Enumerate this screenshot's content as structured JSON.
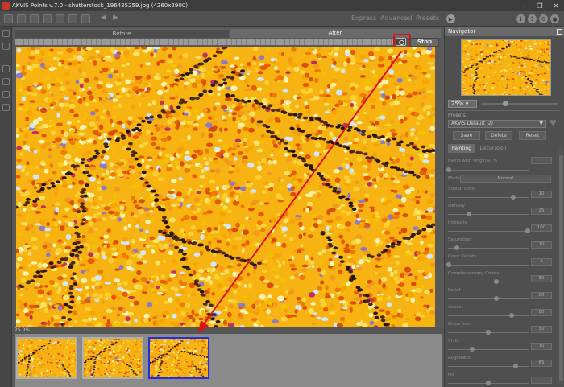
{
  "window": {
    "title": "AKVIS Points v.7.0 - shutterstock_196435259.jpg (4260x2900)",
    "controls": [
      "–",
      "❐",
      "✕"
    ]
  },
  "toolbar": {
    "modes": [
      "Express",
      "Advanced",
      "Presets"
    ],
    "right_icons": [
      "play-icon",
      "info-icon",
      "help-icon",
      "settings-icon",
      "notification-icon"
    ]
  },
  "canvas": {
    "tabs": {
      "before": "Before",
      "after": "After"
    },
    "stop_label": "Stop",
    "zoom_readout": "25.0%"
  },
  "navigator": {
    "title": "Navigator",
    "zoom": "25%"
  },
  "presets": {
    "label": "Presets",
    "selected": "AKVIS Default (2)",
    "buttons": [
      "Save",
      "Delete",
      "Reset"
    ],
    "tabs": [
      "Painting",
      "Decoration"
    ]
  },
  "params": {
    "blend_label": "Blend with Original, %",
    "mode_label": "Mode",
    "mode_value": "Normal",
    "items": [
      {
        "label": "Size of Dots",
        "value": "10",
        "level": 0.82
      },
      {
        "label": "Density",
        "value": "25",
        "level": 0.25
      },
      {
        "label": "Intensity",
        "value": "100",
        "level": 1.0
      },
      {
        "label": "Saturation",
        "value": "10",
        "level": 0.1
      },
      {
        "label": "Color Variety",
        "value": "0",
        "level": 0.0
      },
      {
        "label": "Complementary Colors",
        "value": "60",
        "level": 0.6
      },
      {
        "label": "Relief",
        "value": "60",
        "level": 0.6
      },
      {
        "label": "Aspect",
        "value": "80",
        "level": 0.8
      },
      {
        "label": "Distortion",
        "value": "50",
        "level": 0.5
      },
      {
        "label": "Shift",
        "value": "30",
        "level": 0.3
      },
      {
        "label": "Alignment",
        "value": "85",
        "level": 0.85
      },
      {
        "label": "Fill",
        "value": "",
        "level": 0.5
      }
    ]
  }
}
